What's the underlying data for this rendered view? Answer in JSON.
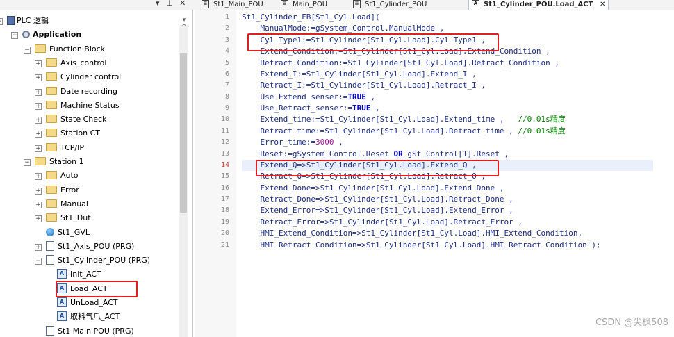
{
  "pane_buttons": [
    "▾",
    "⊥",
    "✕"
  ],
  "tabs": [
    {
      "label": "St1_Main_POU",
      "active": false
    },
    {
      "label": "Main_POU",
      "active": false
    },
    {
      "label": "St1_Cylinder_POU",
      "active": false
    },
    {
      "label": "St1_Cylinder_POU.Load_ACT",
      "active": true
    }
  ],
  "tab_close": "✕",
  "tree": {
    "items": [
      {
        "label": "PLC 逻辑",
        "toggle": "⊟"
      },
      {
        "label": "Application",
        "toggle": "⊟"
      },
      {
        "label": "Function Block",
        "toggle": "⊟"
      },
      {
        "label": "Axis_control",
        "toggle": "⊞"
      },
      {
        "label": "Cylinder control",
        "toggle": "⊞"
      },
      {
        "label": "Date recording",
        "toggle": "⊞"
      },
      {
        "label": "Machine Status",
        "toggle": "⊞"
      },
      {
        "label": "State Check",
        "toggle": "⊞"
      },
      {
        "label": "Station CT",
        "toggle": "⊞"
      },
      {
        "label": "TCP/IP",
        "toggle": "⊞"
      },
      {
        "label": "Station 1",
        "toggle": "⊟"
      },
      {
        "label": "Auto",
        "toggle": "⊞"
      },
      {
        "label": "Error",
        "toggle": "⊞"
      },
      {
        "label": "Manual",
        "toggle": "⊞"
      },
      {
        "label": "St1_Dut",
        "toggle": "⊞"
      },
      {
        "label": "St1_GVL",
        "toggle": ""
      },
      {
        "label": "St1_Axis_POU (PRG)",
        "toggle": "⊞"
      },
      {
        "label": "St1_Cylinder_POU (PRG)",
        "toggle": "⊟"
      },
      {
        "label": "Init_ACT",
        "toggle": ""
      },
      {
        "label": "Load_ACT",
        "toggle": ""
      },
      {
        "label": "UnLoad_ACT",
        "toggle": ""
      },
      {
        "label": "取料气爪_ACT",
        "toggle": ""
      },
      {
        "label": "St1 Main POU (PRG)",
        "toggle": ""
      }
    ]
  },
  "code": {
    "line_numbers": [
      "1",
      "2",
      "3",
      "4",
      "5",
      "6",
      "7",
      "8",
      "9",
      "10",
      "11",
      "12",
      "13",
      "14",
      "15",
      "16",
      "17",
      "18",
      "19",
      "20",
      "21"
    ],
    "lines": [
      "St1_Cylinder_FB[St1_Cyl.Load](",
      "    ManualMode:=gSystem_Control.ManualMode ,",
      "    Cyl_Type1:=St1_Cylinder[St1_Cyl.Load].Cyl_Type1 ,",
      "    Extend_Condition:=St1_Cylinder[St1_Cyl.Load].Extend_Condition ,",
      "    Retract_Condition:=St1_Cylinder[St1_Cyl.Load].Retract_Condition ,",
      "    Extend_I:=St1_Cylinder[St1_Cyl.Load].Extend_I ,",
      "    Retract_I:=St1_Cylinder[St1_Cyl.Load].Retract_I ,",
      "    Use_Extend_senser:=TRUE ,",
      "    Use_Retract_senser:=TRUE ,",
      "    Extend_time:=St1_Cylinder[St1_Cyl.Load].Extend_time ,   //0.01s精度",
      "    Retract_time:=St1_Cylinder[St1_Cyl.Load].Retract_time , //0.01s精度",
      "    Error_time:=3000 ,",
      "    Reset:=gSystem_Control.Reset OR gSt_Control[1].Reset ,",
      "    Extend_Q=>St1_Cylinder[St1_Cyl.Load].Extend_Q ,",
      "    Retract_Q=>St1_Cylinder[St1_Cyl.Load].Retract_Q ,",
      "    Extend_Done=>St1_Cylinder[St1_Cyl.Load].Extend_Done ,",
      "    Retract_Done=>St1_Cylinder[St1_Cyl.Load].Retract_Done ,",
      "    Extend_Error=>St1_Cylinder[St1_Cyl.Load].Extend_Error ,",
      "    Retract_Error=>St1_Cylinder[St1_Cyl.Load].Retract_Error ,",
      "    HMI_Extend_Condition=>St1_Cylinder[St1_Cyl.Load].HMI_Extend_Condition,",
      "    HMI_Retract_Condition=>St1_Cylinder[St1_Cyl.Load].HMI_Retract_Condition );"
    ]
  },
  "watermark": "CSDN @尖枫508",
  "colors": {
    "highlight": "#e02020",
    "keyword": "#0000c8",
    "comment": "#008000"
  }
}
